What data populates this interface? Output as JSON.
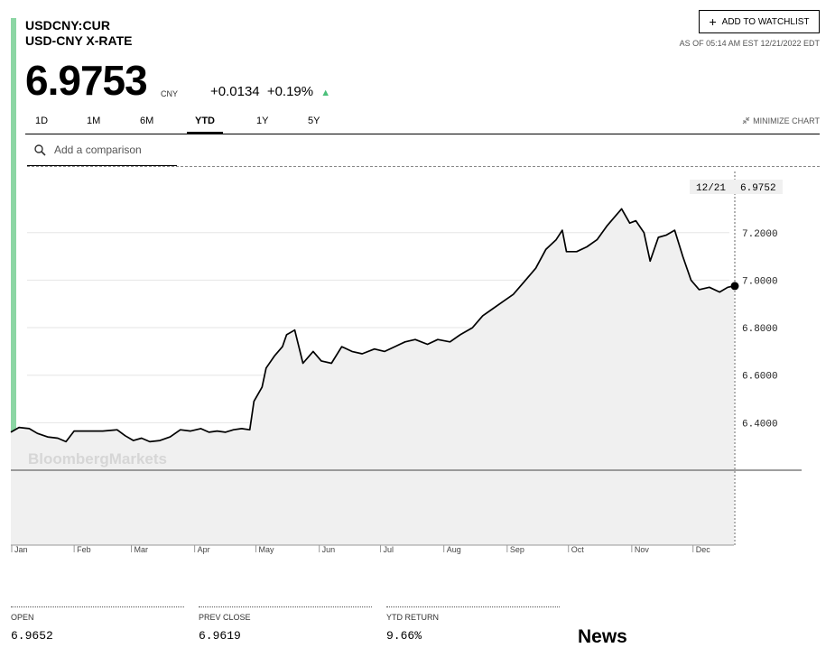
{
  "header": {
    "ticker": "USDCNY:CUR",
    "subtitle": "USD-CNY X-RATE",
    "watchlist_label": "ADD TO WATCHLIST",
    "as_of": "AS OF 05:14 AM EST 12/21/2022 EDT"
  },
  "quote": {
    "price": "6.9753",
    "currency": "CNY",
    "change": "+0.0134",
    "change_pct": "+0.19%",
    "direction_icon": "up-triangle-icon"
  },
  "tabs": [
    "1D",
    "1M",
    "6M",
    "YTD",
    "1Y",
    "5Y"
  ],
  "active_tab": "YTD",
  "minimize_label": "MINIMIZE CHART",
  "compare": {
    "placeholder": "Add a comparison"
  },
  "watermark": "BloombergMarkets",
  "colors": {
    "accent": "#8cd6a4",
    "line": "#000000",
    "area": "#f0f0f0",
    "up": "#4bc07a"
  },
  "stats": [
    {
      "label": "OPEN",
      "value": "6.9652"
    },
    {
      "label": "PREV CLOSE",
      "value": "6.9619"
    },
    {
      "label": "YTD RETURN",
      "value": "9.66%"
    }
  ],
  "news_title": "News",
  "chart_data": {
    "type": "area",
    "title": "",
    "xlabel": "",
    "ylabel": "",
    "x_ticks": [
      "Jan",
      "Feb",
      "Mar",
      "Apr",
      "May",
      "Jun",
      "Jul",
      "Aug",
      "Sep",
      "Oct",
      "Nov",
      "Dec"
    ],
    "y_ticks": [
      "6.4000",
      "6.6000",
      "6.8000",
      "7.0000",
      "7.2000"
    ],
    "ylim": [
      6.2,
      7.37
    ],
    "grid": true,
    "cursor_label": {
      "date": "12/21",
      "value": "6.9752"
    },
    "series": [
      {
        "points": [
          [
            "01-01",
            6.36
          ],
          [
            "01-05",
            6.38
          ],
          [
            "01-10",
            6.375
          ],
          [
            "01-14",
            6.355
          ],
          [
            "01-19",
            6.34
          ],
          [
            "01-24",
            6.335
          ],
          [
            "01-28",
            6.32
          ],
          [
            "02-01",
            6.365
          ],
          [
            "02-08",
            6.365
          ],
          [
            "02-15",
            6.365
          ],
          [
            "02-22",
            6.37
          ],
          [
            "02-26",
            6.345
          ],
          [
            "03-02",
            6.325
          ],
          [
            "03-06",
            6.335
          ],
          [
            "03-10",
            6.32
          ],
          [
            "03-15",
            6.325
          ],
          [
            "03-20",
            6.34
          ],
          [
            "03-25",
            6.37
          ],
          [
            "03-30",
            6.365
          ],
          [
            "04-04",
            6.375
          ],
          [
            "04-08",
            6.36
          ],
          [
            "04-12",
            6.365
          ],
          [
            "04-16",
            6.36
          ],
          [
            "04-20",
            6.37
          ],
          [
            "04-24",
            6.375
          ],
          [
            "04-28",
            6.37
          ],
          [
            "04-30",
            6.49
          ],
          [
            "05-02",
            6.52
          ],
          [
            "05-04",
            6.55
          ],
          [
            "05-06",
            6.63
          ],
          [
            "05-10",
            6.68
          ],
          [
            "05-14",
            6.72
          ],
          [
            "05-16",
            6.77
          ],
          [
            "05-18",
            6.78
          ],
          [
            "05-20",
            6.79
          ],
          [
            "05-24",
            6.65
          ],
          [
            "05-29",
            6.7
          ],
          [
            "06-02",
            6.66
          ],
          [
            "06-07",
            6.65
          ],
          [
            "06-12",
            6.72
          ],
          [
            "06-17",
            6.7
          ],
          [
            "06-22",
            6.69
          ],
          [
            "06-28",
            6.71
          ],
          [
            "07-03",
            6.7
          ],
          [
            "07-08",
            6.72
          ],
          [
            "07-13",
            6.74
          ],
          [
            "07-18",
            6.75
          ],
          [
            "07-24",
            6.73
          ],
          [
            "07-29",
            6.75
          ],
          [
            "08-04",
            6.74
          ],
          [
            "08-09",
            6.77
          ],
          [
            "08-15",
            6.8
          ],
          [
            "08-20",
            6.85
          ],
          [
            "08-25",
            6.88
          ],
          [
            "08-30",
            6.91
          ],
          [
            "09-04",
            6.94
          ],
          [
            "09-10",
            7.0
          ],
          [
            "09-15",
            7.05
          ],
          [
            "09-20",
            7.13
          ],
          [
            "09-25",
            7.17
          ],
          [
            "09-28",
            7.21
          ],
          [
            "09-30",
            7.12
          ],
          [
            "10-05",
            7.12
          ],
          [
            "10-10",
            7.14
          ],
          [
            "10-15",
            7.17
          ],
          [
            "10-20",
            7.23
          ],
          [
            "10-24",
            7.27
          ],
          [
            "10-27",
            7.3
          ],
          [
            "10-31",
            7.24
          ],
          [
            "11-03",
            7.25
          ],
          [
            "11-07",
            7.2
          ],
          [
            "11-10",
            7.08
          ],
          [
            "11-14",
            7.18
          ],
          [
            "11-18",
            7.19
          ],
          [
            "11-22",
            7.21
          ],
          [
            "11-26",
            7.1
          ],
          [
            "11-30",
            7.0
          ],
          [
            "12-04",
            6.96
          ],
          [
            "12-09",
            6.97
          ],
          [
            "12-14",
            6.95
          ],
          [
            "12-18",
            6.97
          ],
          [
            "12-21",
            6.9753
          ]
        ]
      }
    ]
  }
}
